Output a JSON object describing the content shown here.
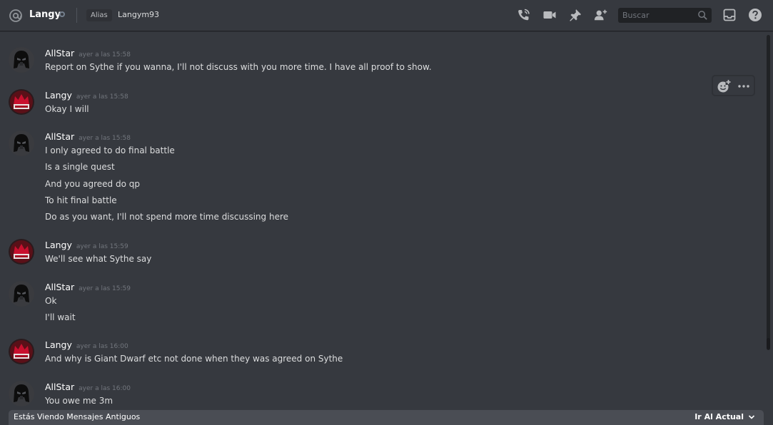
{
  "header": {
    "channel_name": "Langy",
    "alias_tag": "Alias",
    "alias_value": "Langym93",
    "search_placeholder": "Buscar",
    "icons": [
      "at-icon",
      "phone-call-icon",
      "video-call-icon",
      "pin-icon",
      "add-friend-icon",
      "search-icon",
      "inbox-icon",
      "help-icon"
    ]
  },
  "messages": [
    {
      "author": "AllStar",
      "timestamp": "ayer a las 15:58",
      "avatar": "darth-vader-avatar",
      "lines": [
        "Report on Sythe if you wanna, I'll not discuss with you more time. I have all proof to show."
      ]
    },
    {
      "author": "Langy",
      "timestamp": "ayer a las 15:58",
      "avatar": "red-crown-avatar",
      "lines": [
        "Okay I will"
      ]
    },
    {
      "author": "AllStar",
      "timestamp": "ayer a las 15:58",
      "avatar": "darth-vader-avatar",
      "lines": [
        "I only agreed to do final battle",
        "Is a single quest",
        "And you agreed do qp",
        "To hit final battle",
        "Do as you want, I'll not spend more time discussing here"
      ]
    },
    {
      "author": "Langy",
      "timestamp": "ayer a las 15:59",
      "avatar": "red-crown-avatar",
      "lines": [
        "We'll see what Sythe say"
      ]
    },
    {
      "author": "AllStar",
      "timestamp": "ayer a las 15:59",
      "avatar": "darth-vader-avatar",
      "lines": [
        "Ok",
        "I'll wait"
      ]
    },
    {
      "author": "Langy",
      "timestamp": "ayer a las 16:00",
      "avatar": "red-crown-avatar",
      "lines": [
        "And why is Giant Dwarf etc not done when they was agreed on Sythe"
      ]
    },
    {
      "author": "AllStar",
      "timestamp": "ayer a las 16:00",
      "avatar": "darth-vader-avatar",
      "lines": [
        "You owe me 3m"
      ]
    }
  ],
  "hover_toolbar": {
    "icons": [
      "add-reaction-icon",
      "more-options-icon"
    ]
  },
  "older_messages_bar": {
    "text": "Estás Viendo Mensajes Antiguos",
    "jump_label": "Ir Al Actual"
  },
  "colors": {
    "background": "#36393f",
    "search_bg": "#202225",
    "bar_bg": "#4a4d54",
    "langy_avatar_red": "#c8102e"
  }
}
